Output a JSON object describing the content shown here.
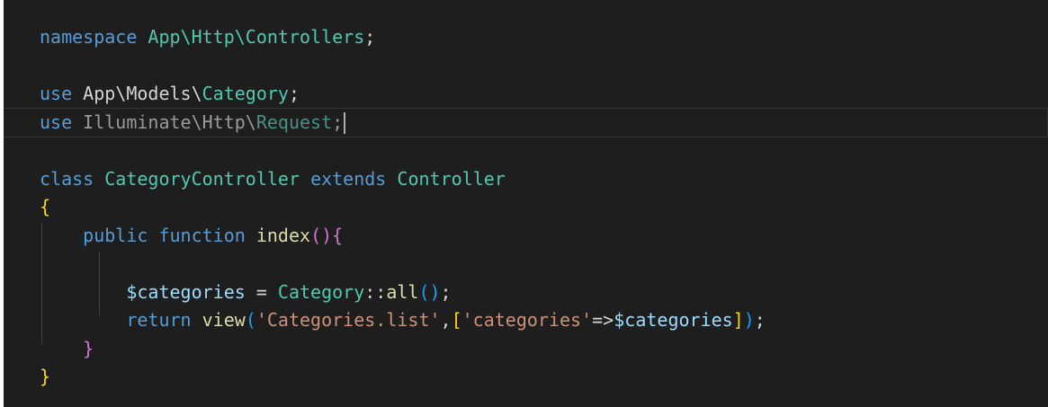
{
  "editor": {
    "lines": [
      {
        "tokens": [
          {
            "text": "namespace",
            "class": "kw"
          },
          {
            "text": " ",
            "class": "punct"
          },
          {
            "text": "App\\Http\\Controllers",
            "class": "ns"
          },
          {
            "text": ";",
            "class": "punct"
          }
        ]
      },
      {
        "tokens": []
      },
      {
        "tokens": [
          {
            "text": "use",
            "class": "kw"
          },
          {
            "text": " ",
            "class": "punct"
          },
          {
            "text": "App\\Models\\",
            "class": "name"
          },
          {
            "text": "Category",
            "class": "cls"
          },
          {
            "text": ";",
            "class": "punct"
          }
        ]
      },
      {
        "current": true,
        "cursor": true,
        "tokens": [
          {
            "text": "use",
            "class": "kw"
          },
          {
            "text": " ",
            "class": "punct"
          },
          {
            "text": "Illuminate\\Http\\",
            "class": "name-muted"
          },
          {
            "text": "Request",
            "class": "cls-muted"
          },
          {
            "text": ";",
            "class": "punct-muted"
          }
        ]
      },
      {
        "tokens": []
      },
      {
        "tokens": [
          {
            "text": "class",
            "class": "kw"
          },
          {
            "text": " ",
            "class": "punct"
          },
          {
            "text": "CategoryController",
            "class": "cls"
          },
          {
            "text": " ",
            "class": "punct"
          },
          {
            "text": "extends",
            "class": "kw"
          },
          {
            "text": " ",
            "class": "punct"
          },
          {
            "text": "Controller",
            "class": "cls"
          }
        ]
      },
      {
        "tokens": [
          {
            "text": "{",
            "class": "bracket-gold"
          }
        ]
      },
      {
        "tokens": [
          {
            "text": "    ",
            "class": "punct"
          },
          {
            "text": "public",
            "class": "kw"
          },
          {
            "text": " ",
            "class": "punct"
          },
          {
            "text": "function",
            "class": "kw"
          },
          {
            "text": " ",
            "class": "punct"
          },
          {
            "text": "index",
            "class": "fn"
          },
          {
            "text": "()",
            "class": "bracket-pink"
          },
          {
            "text": "{",
            "class": "bracket-pink"
          }
        ]
      },
      {
        "tokens": []
      },
      {
        "tokens": [
          {
            "text": "        ",
            "class": "punct"
          },
          {
            "text": "$categories",
            "class": "var"
          },
          {
            "text": " = ",
            "class": "punct"
          },
          {
            "text": "Category",
            "class": "cls"
          },
          {
            "text": "::",
            "class": "punct"
          },
          {
            "text": "all",
            "class": "fn"
          },
          {
            "text": "()",
            "class": "bracket-blue"
          },
          {
            "text": ";",
            "class": "punct"
          }
        ]
      },
      {
        "tokens": [
          {
            "text": "        ",
            "class": "punct"
          },
          {
            "text": "return",
            "class": "kw"
          },
          {
            "text": " ",
            "class": "punct"
          },
          {
            "text": "view",
            "class": "fn"
          },
          {
            "text": "(",
            "class": "bracket-blue"
          },
          {
            "text": "'Categories.list'",
            "class": "str"
          },
          {
            "text": ",",
            "class": "punct"
          },
          {
            "text": "[",
            "class": "bracket-gold"
          },
          {
            "text": "'categories'",
            "class": "str"
          },
          {
            "text": "=>",
            "class": "punct"
          },
          {
            "text": "$categories",
            "class": "var"
          },
          {
            "text": "]",
            "class": "bracket-gold"
          },
          {
            "text": ")",
            "class": "bracket-blue"
          },
          {
            "text": ";",
            "class": "punct"
          }
        ]
      },
      {
        "tokens": [
          {
            "text": "    ",
            "class": "punct"
          },
          {
            "text": "}",
            "class": "bracket-pink"
          }
        ]
      },
      {
        "tokens": [
          {
            "text": "}",
            "class": "bracket-gold"
          }
        ]
      }
    ]
  }
}
